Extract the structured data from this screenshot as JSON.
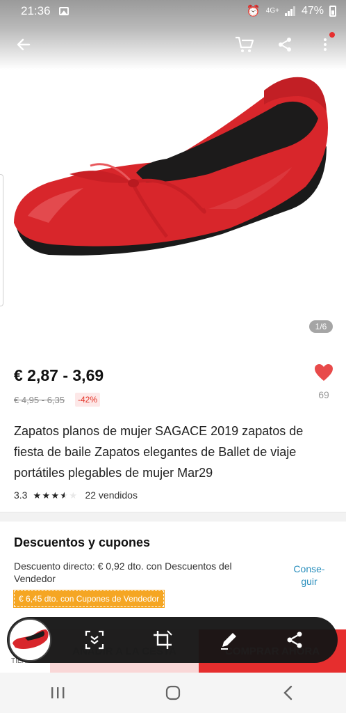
{
  "status_bar": {
    "time": "21:36",
    "network": "4G+",
    "battery": "47%"
  },
  "header": {
    "back_icon": "arrow-left-icon",
    "cart_icon": "shopping-cart-icon",
    "share_icon": "share-icon",
    "more_icon": "more-vertical-icon",
    "notification_dot_color": "#e62e2e"
  },
  "gallery": {
    "counter": "1/6"
  },
  "price": {
    "current": "€ 2,87 - 3,69",
    "original": "€ 4,95 - 6,35",
    "discount": "-42%"
  },
  "wishlist": {
    "count": "69",
    "color": "#e84a4a"
  },
  "product": {
    "title": "Zapatos planos de mujer SAGACE 2019 zapatos de fiesta de baile Zapatos elegantes de Ballet de viaje portátiles plegables de mujer Mar29",
    "rating": "3.3",
    "rating_value": 3.3,
    "sold": "22 vendidos"
  },
  "coupons": {
    "title": "Descuentos y cupones",
    "direct_discount": "Descuento directo: € 0,92 dto. con Descuentos del Vendedor",
    "get_link_line1": "Conse-",
    "get_link_line2": "guir",
    "coupon_tag": "€ 6,45 dto. con Cupones de Vendedor"
  },
  "buy_bar": {
    "store_label": "TIEN",
    "add_to_cart": "AÑADIR A LA CESTA",
    "buy_now": "COMPRAR AHORA"
  },
  "screenshot_toolbar": {
    "tools": [
      "scroll-capture-icon",
      "crop-icon",
      "edit-pen-icon",
      "share-icon"
    ]
  },
  "nav": {
    "recents": "recents-icon",
    "home": "home-icon",
    "back": "back-icon"
  },
  "colors": {
    "accent_red": "#e62e2e",
    "coupon_orange": "#f5a623",
    "link_blue": "#2a8fbd"
  }
}
